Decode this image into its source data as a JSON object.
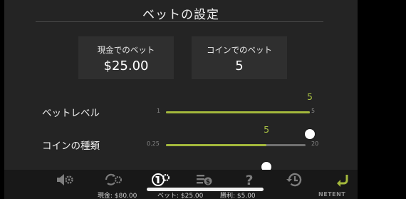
{
  "dialog": {
    "title": "ベットの設定"
  },
  "cards": {
    "cash_bet": {
      "label": "現金でのベット",
      "value": "$25.00"
    },
    "coin_bet": {
      "label": "コインでのベット",
      "value": "5"
    }
  },
  "bet_level": {
    "label": "ベットレベル",
    "min": "1",
    "max": "5",
    "value": "5",
    "fraction": 1.0
  },
  "coin_value": {
    "label": "コインの種類",
    "min": "0.25",
    "max": "20",
    "value": "5",
    "fraction": 0.72
  },
  "toolbar": {
    "icons": [
      "sound-settings-icon",
      "autoplay-settings-icon",
      "bet-settings-icon",
      "paytable-icon",
      "help-icon",
      "history-icon",
      "back-icon"
    ],
    "active_icon": "bet-settings-icon"
  },
  "status": {
    "cash": "現金: $80.00",
    "bet": "ベット: $25.00",
    "win": "勝利: $5.00",
    "brand": "NETENT"
  },
  "colors": {
    "accent": "#a3b83c",
    "accent_text": "#a8c144",
    "panel": "#242424",
    "card": "#2f2f2f"
  }
}
